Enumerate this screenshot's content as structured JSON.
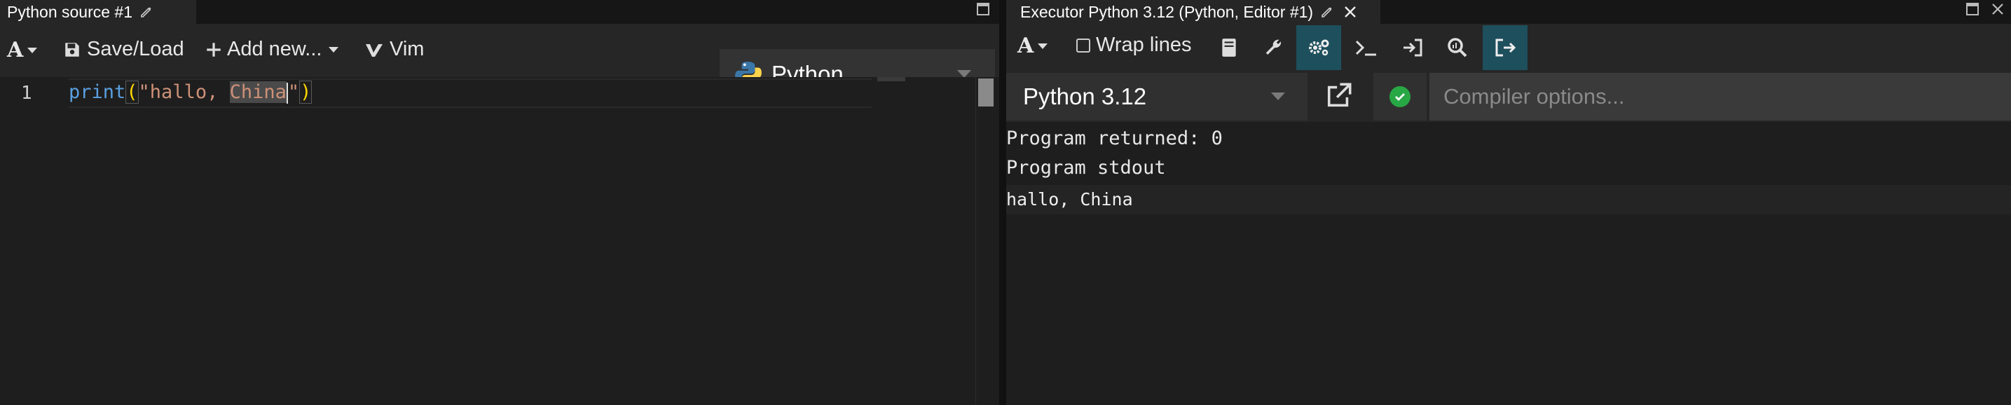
{
  "left": {
    "tab_title": "Python source #1",
    "toolbar": {
      "font_label": "A",
      "save_load": "Save/Load",
      "add_new": "Add new...",
      "vim": "Vim"
    },
    "language": "Python",
    "editor": {
      "line_number": "1",
      "code": {
        "fn": "print",
        "open": "(",
        "str_start": "\"hallo, ",
        "selected": "China",
        "str_end": "\"",
        "close": ")"
      }
    }
  },
  "right": {
    "tab_title": "Executor Python 3.12 (Python, Editor #1)",
    "toolbar": {
      "font_label": "A",
      "wrap_lines": "Wrap lines"
    },
    "compiler": "Python 3.12",
    "compiler_options_placeholder": "Compiler options...",
    "output": {
      "returned": "Program returned: 0",
      "stdout_header": "Program stdout",
      "stdout_line": "hallo, China"
    }
  },
  "colors": {
    "accent_active": "#1e4f5c",
    "ok_green": "#28a745"
  }
}
